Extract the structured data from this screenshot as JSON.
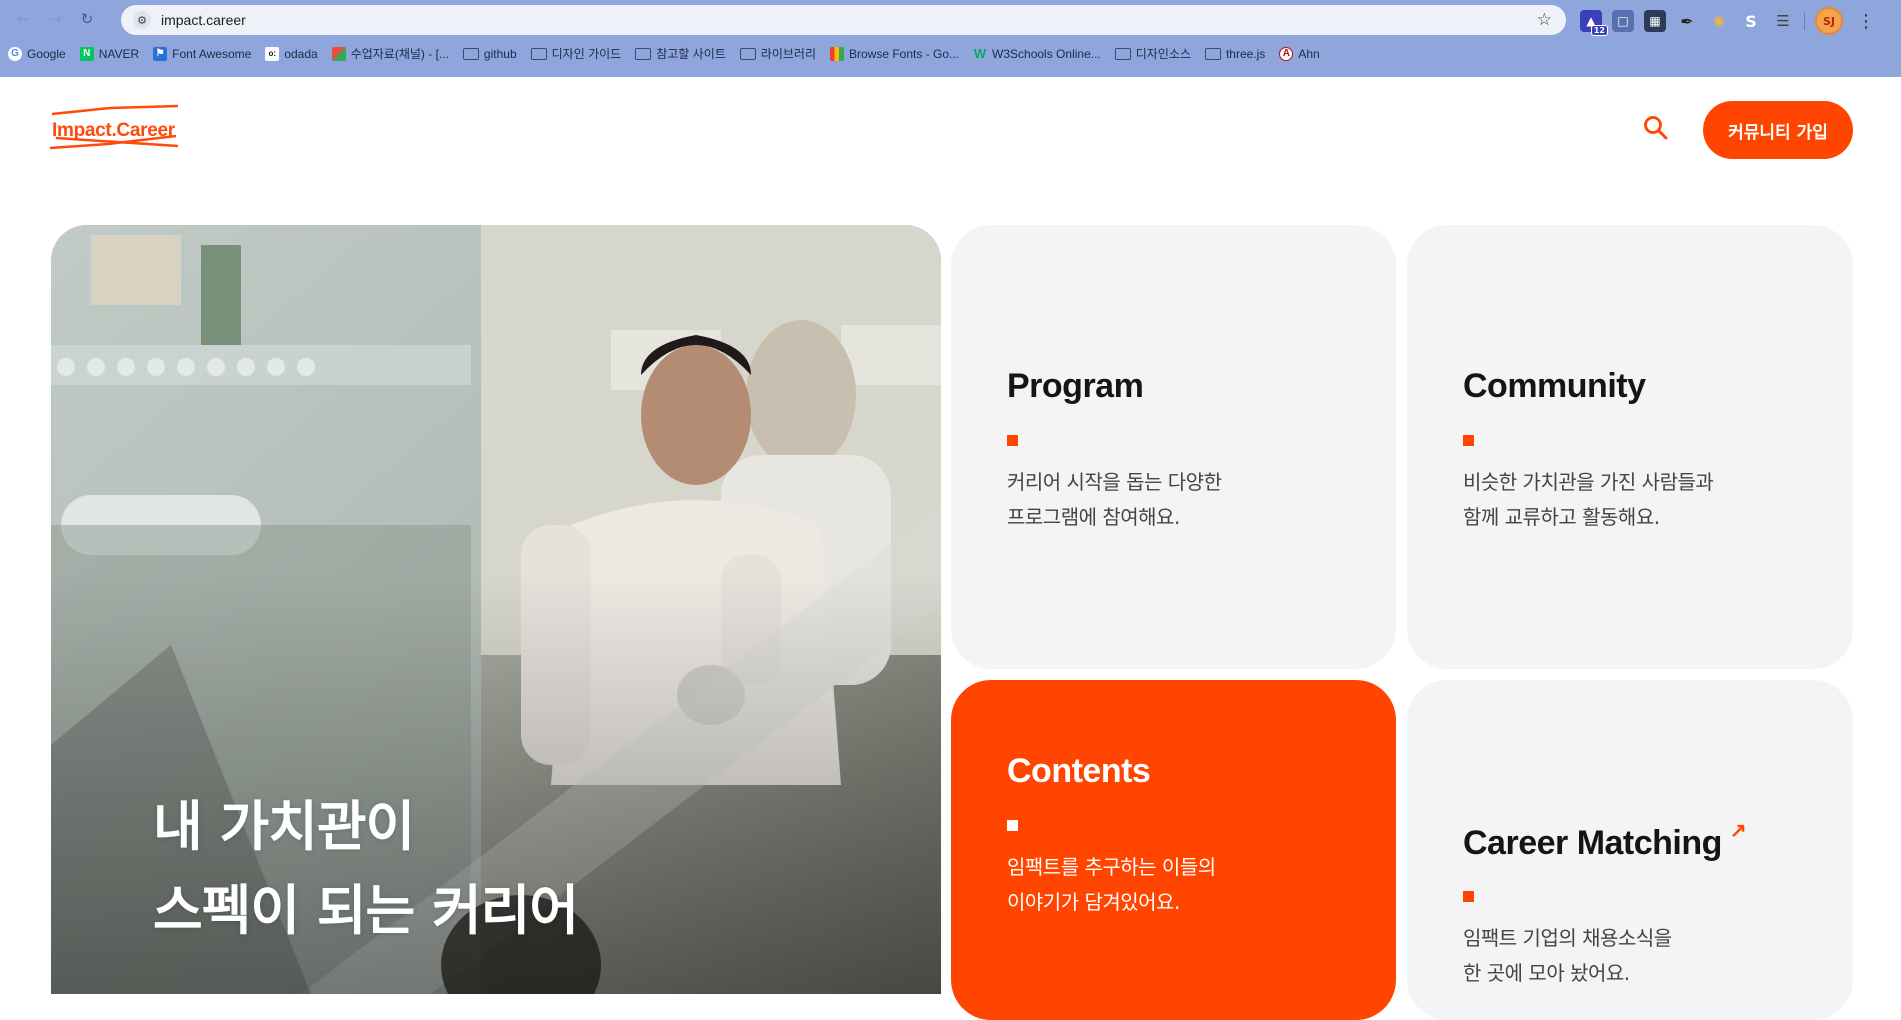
{
  "browser": {
    "url": "impact.career",
    "bookmarks": [
      {
        "label": "Google",
        "icon": "google-icon"
      },
      {
        "label": "NAVER",
        "icon": "naver-icon"
      },
      {
        "label": "Font Awesome",
        "icon": "font-awesome-icon"
      },
      {
        "label": "odada",
        "icon": "odada-icon"
      },
      {
        "label": "수업자료(채널) - [...",
        "icon": "multicolor-icon"
      },
      {
        "label": "github",
        "icon": "folder-icon"
      },
      {
        "label": "디자인 가이드",
        "icon": "folder-icon"
      },
      {
        "label": "참고할 사이트",
        "icon": "folder-icon"
      },
      {
        "label": "라이브러리",
        "icon": "folder-icon"
      },
      {
        "label": "Browse Fonts - Go...",
        "icon": "google-fonts-icon"
      },
      {
        "label": "W3Schools Online...",
        "icon": "w3schools-icon"
      },
      {
        "label": "디자인소스",
        "icon": "folder-icon"
      },
      {
        "label": "three.js",
        "icon": "folder-icon"
      },
      {
        "label": "Ahn",
        "icon": "ahn-icon"
      }
    ],
    "extension_badge": "12",
    "profile_initials": "SJ"
  },
  "header": {
    "logo": "Impact.Career",
    "join_button": "커뮤니티 가입"
  },
  "hero": {
    "title_line1": "내 가치관이",
    "title_line2": "스펙이 되는 커리어"
  },
  "cards": {
    "program": {
      "title": "Program",
      "desc": "커리어 시작을 돕는 다양한\n프로그램에 참여해요."
    },
    "community": {
      "title": "Community",
      "desc": "비슷한 가치관을 가진 사람들과\n함께 교류하고 활동해요."
    },
    "contents": {
      "title": "Contents",
      "desc": "임팩트를 추구하는 이들의\n이야기가 담겨있어요."
    },
    "career_matching": {
      "title": "Career Matching",
      "desc": "임팩트 기업의 채용소식을\n한 곳에 모아 놨어요."
    }
  },
  "colors": {
    "accent": "#ff4500",
    "card_bg": "#f4f4f4"
  }
}
